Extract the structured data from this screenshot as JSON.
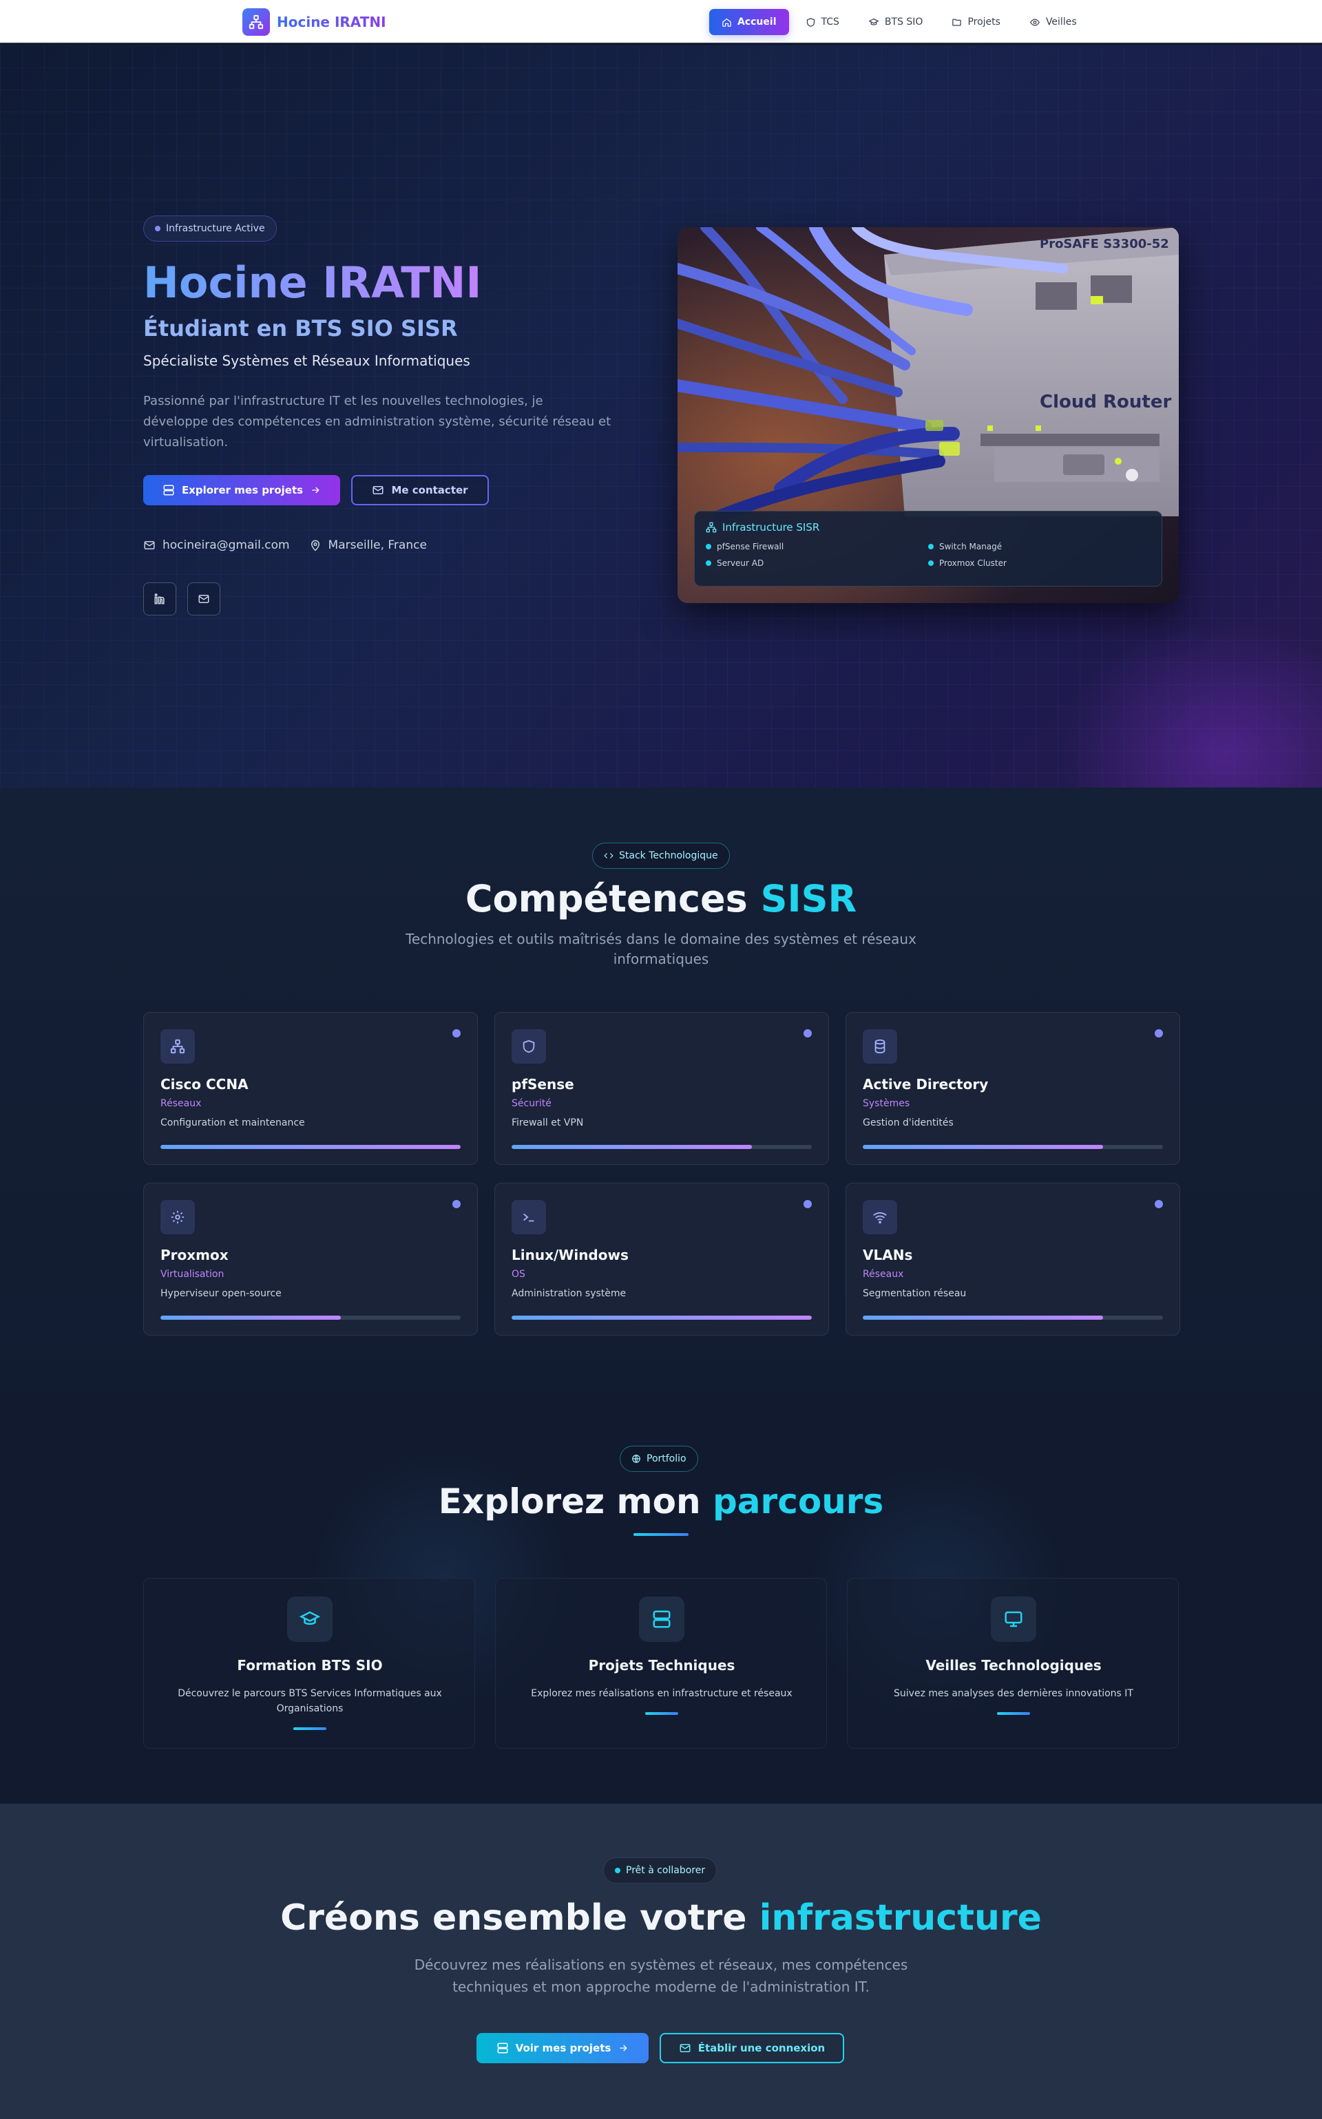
{
  "nav": {
    "brand": "Hocine IRATNI",
    "items": [
      {
        "label": "Accueil",
        "icon": "home-icon",
        "active": true
      },
      {
        "label": "TCS",
        "icon": "shield-icon",
        "active": false
      },
      {
        "label": "BTS SIO",
        "icon": "graduation-cap-icon",
        "active": false
      },
      {
        "label": "Projets",
        "icon": "folder-icon",
        "active": false
      },
      {
        "label": "Veilles",
        "icon": "eye-icon",
        "active": false
      }
    ]
  },
  "hero": {
    "badge": "Infrastructure Active",
    "name": "Hocine IRATNI",
    "subtitle": "Étudiant en BTS SIO SISR",
    "specialty": "Spécialiste Systèmes et Réseaux Informatiques",
    "description": "Passionné par l'infrastructure IT et les nouvelles technologies, je développe des compétences en administration système, sécurité réseau et virtualisation.",
    "primary_button": "Explorer mes projets",
    "secondary_button": "Me contacter",
    "email": "hocineira@gmail.com",
    "location": "Marseille, France",
    "image": {
      "label_sticker": "ProSAFE S3300-52",
      "label_device": "Cloud Router Switch"
    },
    "infra_card": {
      "title": "Infrastructure SISR",
      "items": [
        "pfSense Firewall",
        "Switch Managé",
        "Serveur AD",
        "Proxmox Cluster"
      ]
    }
  },
  "skills": {
    "badge": "Stack Technologique",
    "title_main": "Compétences",
    "title_accent": "SISR",
    "subtitle": "Technologies et outils maîtrisés dans le domaine des systèmes et réseaux informatiques",
    "cards": [
      {
        "name": "Cisco CCNA",
        "category": "Réseaux",
        "desc": "Configuration et maintenance",
        "level": 1.0,
        "icon": "network-icon"
      },
      {
        "name": "pfSense",
        "category": "Sécurité",
        "desc": "Firewall et VPN",
        "level": 0.8,
        "icon": "shield-icon"
      },
      {
        "name": "Active Directory",
        "category": "Systèmes",
        "desc": "Gestion d'identités",
        "level": 0.8,
        "icon": "database-icon"
      },
      {
        "name": "Proxmox",
        "category": "Virtualisation",
        "desc": "Hyperviseur open-source",
        "level": 0.6,
        "icon": "gear-icon"
      },
      {
        "name": "Linux/Windows",
        "category": "OS",
        "desc": "Administration système",
        "level": 1.0,
        "icon": "terminal-icon"
      },
      {
        "name": "VLANs",
        "category": "Réseaux",
        "desc": "Segmentation réseau",
        "level": 0.8,
        "icon": "wifi-icon"
      }
    ]
  },
  "portfolio": {
    "badge": "Portfolio",
    "title_main": "Explorez mon",
    "title_accent": "parcours",
    "cards": [
      {
        "title": "Formation BTS SIO",
        "desc": "Découvrez le parcours BTS Services Informatiques aux Organisations",
        "icon": "graduation-cap-icon"
      },
      {
        "title": "Projets Techniques",
        "desc": "Explorez mes réalisations en infrastructure et réseaux",
        "icon": "server-icon"
      },
      {
        "title": "Veilles Technologiques",
        "desc": "Suivez mes analyses des dernières innovations IT",
        "icon": "monitor-icon"
      }
    ]
  },
  "cta": {
    "badge": "Prêt à collaborer",
    "title_main": "Créons ensemble votre",
    "title_accent": "infrastructure",
    "subtitle": "Découvrez mes réalisations en systèmes et réseaux, mes compétences techniques et mon approche moderne de l'administration IT.",
    "primary_button": "Voir mes projets",
    "secondary_button": "Établir une connexion"
  },
  "colors": {
    "accent_blue": "#2563eb",
    "accent_purple": "#9333ea",
    "accent_cyan": "#22d3ee",
    "background": "#101828"
  }
}
